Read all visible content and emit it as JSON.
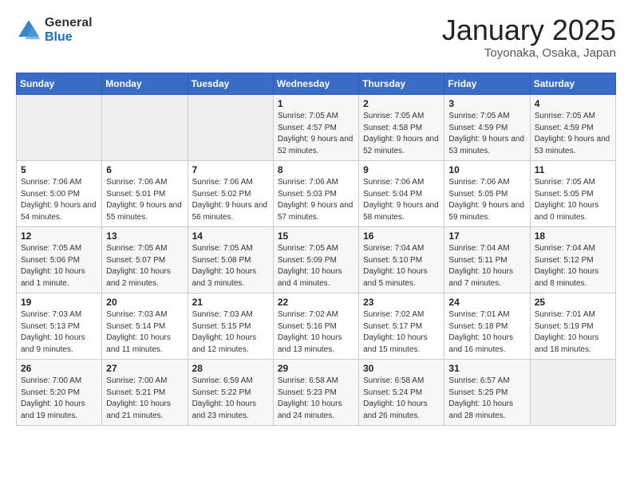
{
  "header": {
    "logo_general": "General",
    "logo_blue": "Blue",
    "title": "January 2025",
    "location": "Toyonaka, Osaka, Japan"
  },
  "days_of_week": [
    "Sunday",
    "Monday",
    "Tuesday",
    "Wednesday",
    "Thursday",
    "Friday",
    "Saturday"
  ],
  "weeks": [
    [
      {
        "day": "",
        "info": ""
      },
      {
        "day": "",
        "info": ""
      },
      {
        "day": "",
        "info": ""
      },
      {
        "day": "1",
        "info": "Sunrise: 7:05 AM\nSunset: 4:57 PM\nDaylight: 9 hours and 52 minutes."
      },
      {
        "day": "2",
        "info": "Sunrise: 7:05 AM\nSunset: 4:58 PM\nDaylight: 9 hours and 52 minutes."
      },
      {
        "day": "3",
        "info": "Sunrise: 7:05 AM\nSunset: 4:59 PM\nDaylight: 9 hours and 53 minutes."
      },
      {
        "day": "4",
        "info": "Sunrise: 7:05 AM\nSunset: 4:59 PM\nDaylight: 9 hours and 53 minutes."
      }
    ],
    [
      {
        "day": "5",
        "info": "Sunrise: 7:06 AM\nSunset: 5:00 PM\nDaylight: 9 hours and 54 minutes."
      },
      {
        "day": "6",
        "info": "Sunrise: 7:06 AM\nSunset: 5:01 PM\nDaylight: 9 hours and 55 minutes."
      },
      {
        "day": "7",
        "info": "Sunrise: 7:06 AM\nSunset: 5:02 PM\nDaylight: 9 hours and 56 minutes."
      },
      {
        "day": "8",
        "info": "Sunrise: 7:06 AM\nSunset: 5:03 PM\nDaylight: 9 hours and 57 minutes."
      },
      {
        "day": "9",
        "info": "Sunrise: 7:06 AM\nSunset: 5:04 PM\nDaylight: 9 hours and 58 minutes."
      },
      {
        "day": "10",
        "info": "Sunrise: 7:06 AM\nSunset: 5:05 PM\nDaylight: 9 hours and 59 minutes."
      },
      {
        "day": "11",
        "info": "Sunrise: 7:05 AM\nSunset: 5:05 PM\nDaylight: 10 hours and 0 minutes."
      }
    ],
    [
      {
        "day": "12",
        "info": "Sunrise: 7:05 AM\nSunset: 5:06 PM\nDaylight: 10 hours and 1 minute."
      },
      {
        "day": "13",
        "info": "Sunrise: 7:05 AM\nSunset: 5:07 PM\nDaylight: 10 hours and 2 minutes."
      },
      {
        "day": "14",
        "info": "Sunrise: 7:05 AM\nSunset: 5:08 PM\nDaylight: 10 hours and 3 minutes."
      },
      {
        "day": "15",
        "info": "Sunrise: 7:05 AM\nSunset: 5:09 PM\nDaylight: 10 hours and 4 minutes."
      },
      {
        "day": "16",
        "info": "Sunrise: 7:04 AM\nSunset: 5:10 PM\nDaylight: 10 hours and 5 minutes."
      },
      {
        "day": "17",
        "info": "Sunrise: 7:04 AM\nSunset: 5:11 PM\nDaylight: 10 hours and 7 minutes."
      },
      {
        "day": "18",
        "info": "Sunrise: 7:04 AM\nSunset: 5:12 PM\nDaylight: 10 hours and 8 minutes."
      }
    ],
    [
      {
        "day": "19",
        "info": "Sunrise: 7:03 AM\nSunset: 5:13 PM\nDaylight: 10 hours and 9 minutes."
      },
      {
        "day": "20",
        "info": "Sunrise: 7:03 AM\nSunset: 5:14 PM\nDaylight: 10 hours and 11 minutes."
      },
      {
        "day": "21",
        "info": "Sunrise: 7:03 AM\nSunset: 5:15 PM\nDaylight: 10 hours and 12 minutes."
      },
      {
        "day": "22",
        "info": "Sunrise: 7:02 AM\nSunset: 5:16 PM\nDaylight: 10 hours and 13 minutes."
      },
      {
        "day": "23",
        "info": "Sunrise: 7:02 AM\nSunset: 5:17 PM\nDaylight: 10 hours and 15 minutes."
      },
      {
        "day": "24",
        "info": "Sunrise: 7:01 AM\nSunset: 5:18 PM\nDaylight: 10 hours and 16 minutes."
      },
      {
        "day": "25",
        "info": "Sunrise: 7:01 AM\nSunset: 5:19 PM\nDaylight: 10 hours and 18 minutes."
      }
    ],
    [
      {
        "day": "26",
        "info": "Sunrise: 7:00 AM\nSunset: 5:20 PM\nDaylight: 10 hours and 19 minutes."
      },
      {
        "day": "27",
        "info": "Sunrise: 7:00 AM\nSunset: 5:21 PM\nDaylight: 10 hours and 21 minutes."
      },
      {
        "day": "28",
        "info": "Sunrise: 6:59 AM\nSunset: 5:22 PM\nDaylight: 10 hours and 23 minutes."
      },
      {
        "day": "29",
        "info": "Sunrise: 6:58 AM\nSunset: 5:23 PM\nDaylight: 10 hours and 24 minutes."
      },
      {
        "day": "30",
        "info": "Sunrise: 6:58 AM\nSunset: 5:24 PM\nDaylight: 10 hours and 26 minutes."
      },
      {
        "day": "31",
        "info": "Sunrise: 6:57 AM\nSunset: 5:25 PM\nDaylight: 10 hours and 28 minutes."
      },
      {
        "day": "",
        "info": ""
      }
    ]
  ]
}
